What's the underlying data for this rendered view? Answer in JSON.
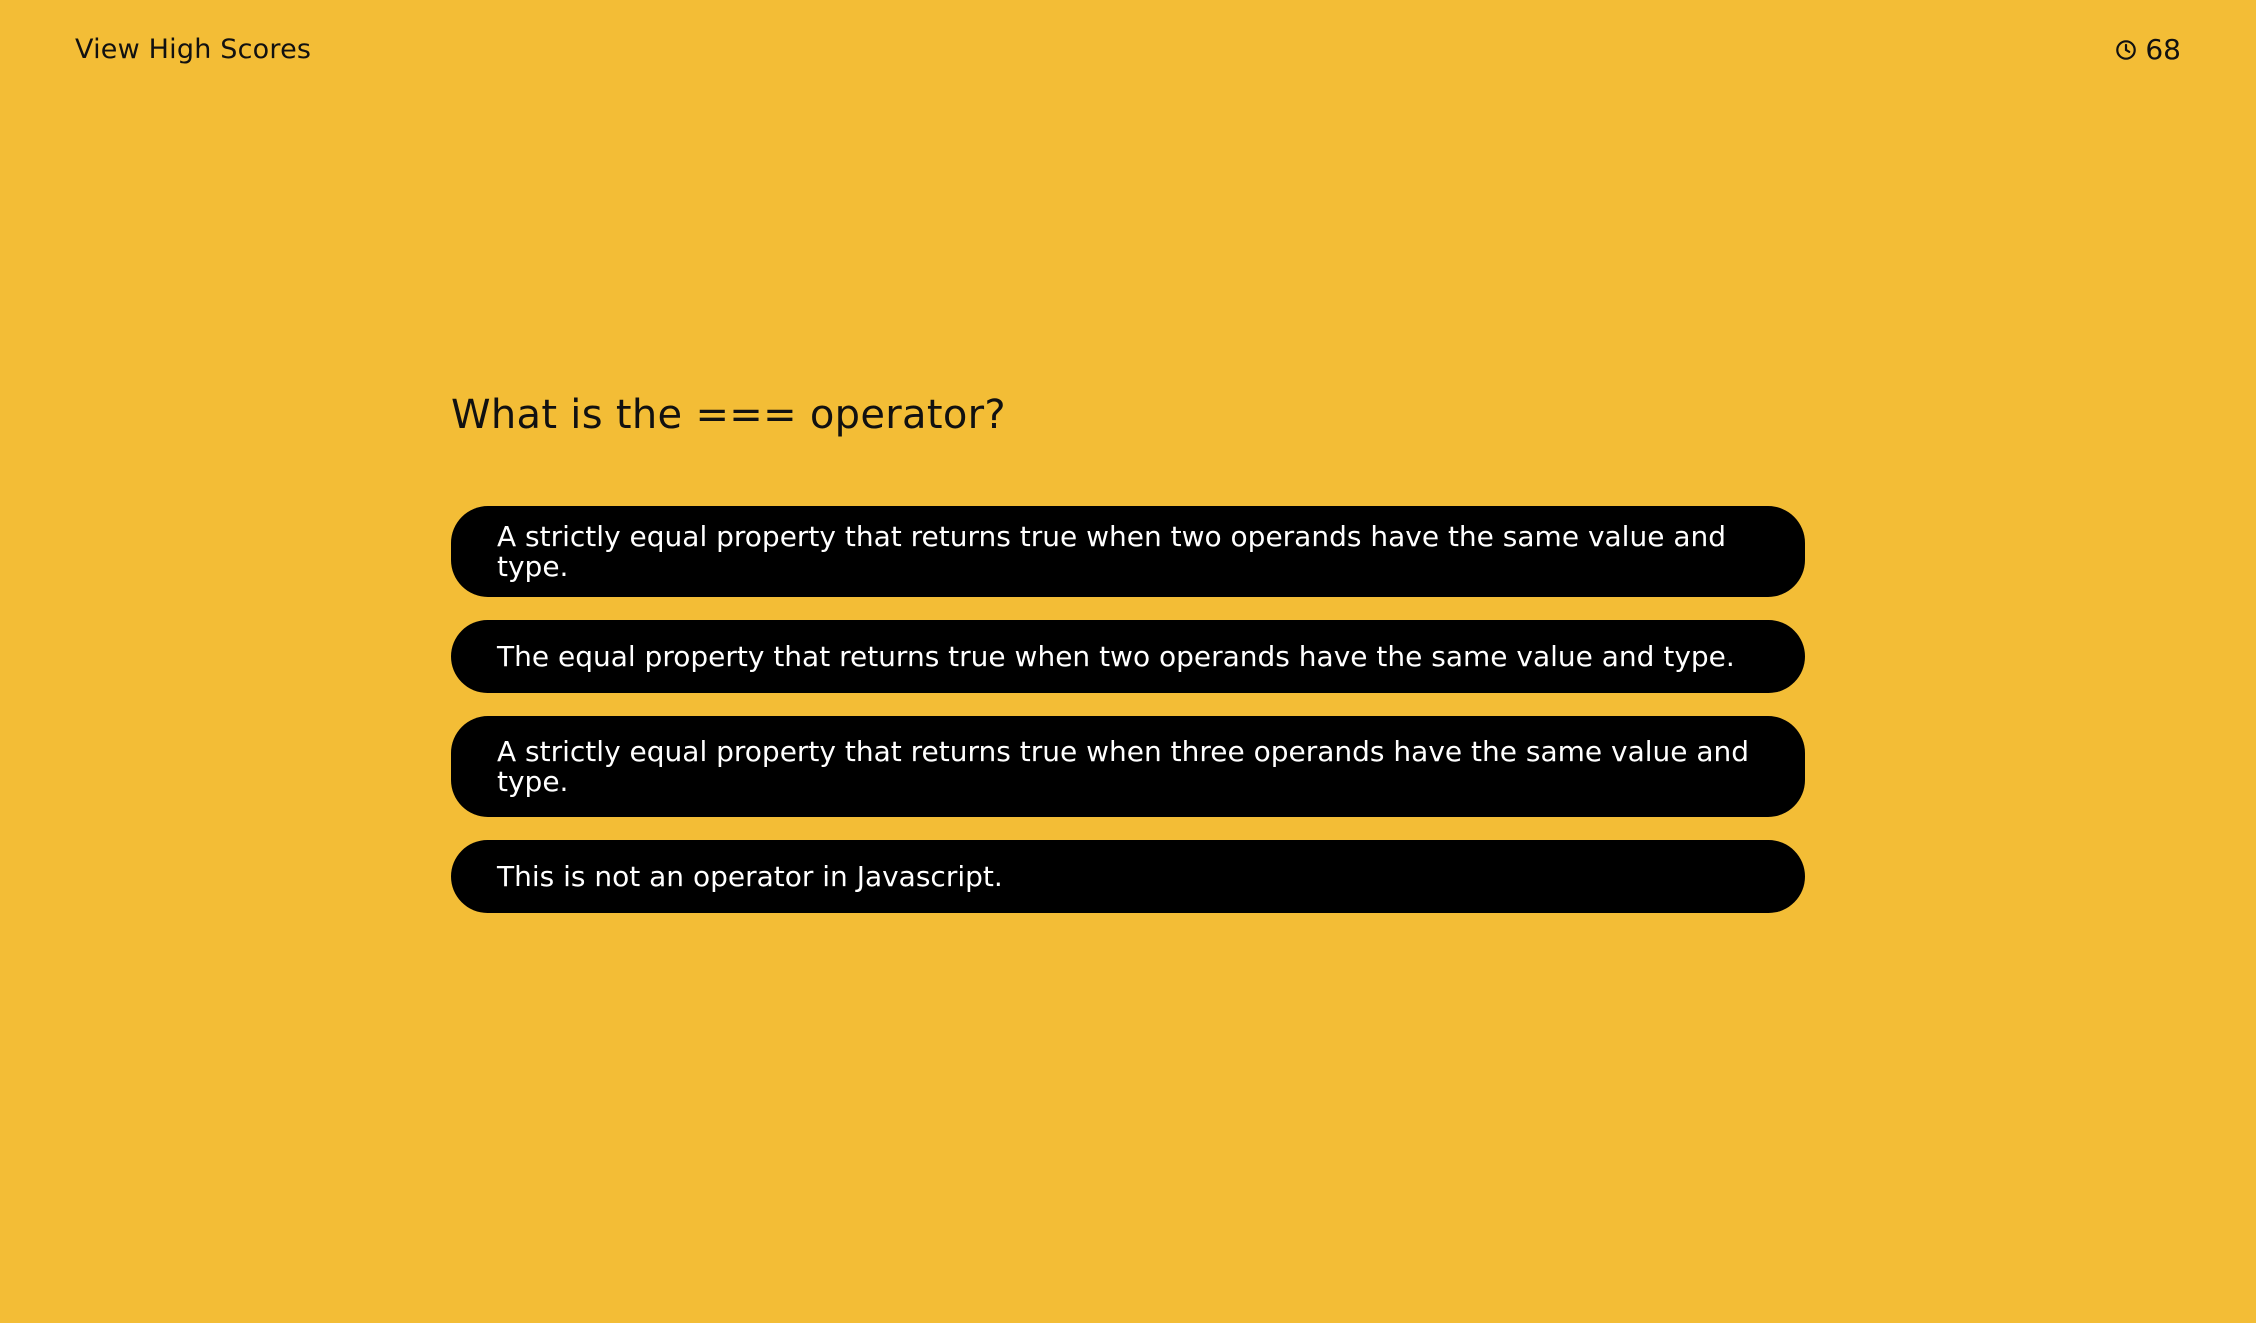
{
  "header": {
    "high_scores_label": "View High Scores",
    "timer_icon": "clock-icon",
    "timer_value": "68"
  },
  "quiz": {
    "question": "What is the === operator?",
    "choices": [
      {
        "label": "A strictly equal property that returns true when two operands have the same value and type."
      },
      {
        "label": "The equal property that returns true when two operands have the same value and type."
      },
      {
        "label": "A strictly equal property that returns true when three operands have the same value and type."
      },
      {
        "label": "This is not an operator in Javascript."
      }
    ]
  },
  "colors": {
    "background": "#F3BD36",
    "button_background": "#000000",
    "button_text": "#FFFFFF",
    "text": "#111111"
  }
}
